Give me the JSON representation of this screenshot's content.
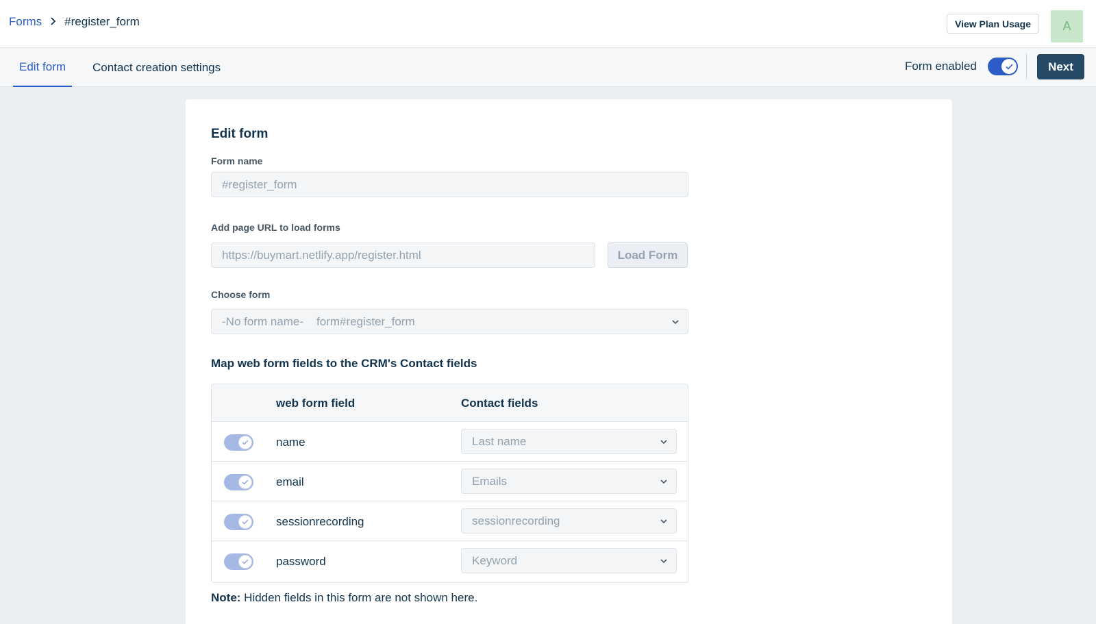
{
  "breadcrumb": {
    "parent": "Forms",
    "current": "#register_form"
  },
  "header": {
    "plan_button": "View Plan Usage",
    "avatar_initial": "A"
  },
  "tabs": {
    "edit": "Edit form",
    "contact": "Contact creation settings"
  },
  "controls": {
    "form_enabled_label": "Form enabled",
    "form_enabled": true,
    "next_label": "Next"
  },
  "edit": {
    "title": "Edit form",
    "form_name_label": "Form name",
    "form_name_value": "#register_form",
    "url_label": "Add page URL to load forms",
    "url_value": "https://buymart.netlify.app/register.html",
    "load_button": "Load Form",
    "choose_label": "Choose form",
    "choose_value_name": "-No form name-",
    "choose_value_id": "form#register_form",
    "map_heading": "Map web form fields to the CRM's Contact fields",
    "col_webfield": "web form field",
    "col_contact": "Contact fields",
    "rows": [
      {
        "field": "name",
        "contact": "Last name",
        "enabled": true
      },
      {
        "field": "email",
        "contact": "Emails",
        "enabled": true
      },
      {
        "field": "sessionrecording",
        "contact": "sessionrecording",
        "enabled": true
      },
      {
        "field": "password",
        "contact": "Keyword",
        "enabled": true
      }
    ],
    "note_bold": "Note:",
    "note_text": " Hidden fields in this form are not shown here."
  }
}
